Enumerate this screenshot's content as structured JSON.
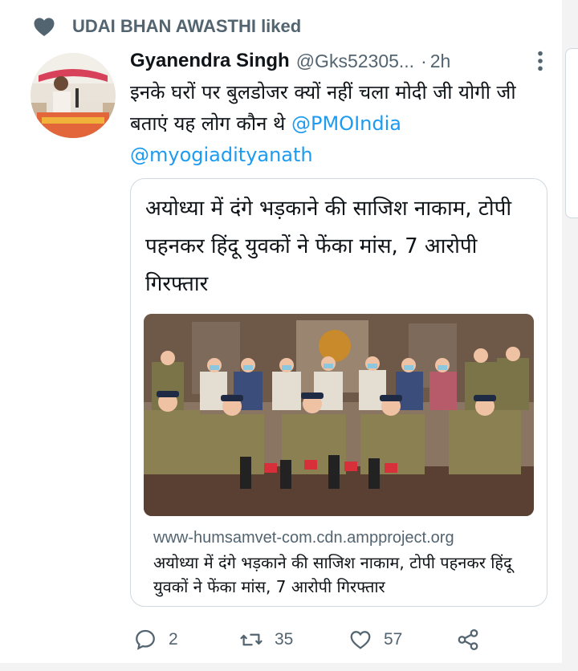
{
  "social_context": {
    "text": "UDAI BHAN AWASTHI liked",
    "icon": "heart-icon"
  },
  "tweet": {
    "author_name": "Gyanendra Singh",
    "handle": "@Gks52305...",
    "separator": "·",
    "time": "2h",
    "text_plain": "इनके घरों पर बुलडोजर क्यों नहीं चला मोदी जी योगी जी बताएं यह लोग कौन थे",
    "mention_1": "@PMOIndia",
    "mention_2": "@myogiadityanath"
  },
  "link_card": {
    "headline": "अयोध्या में दंगे भड़काने की साजिश नाकाम, टोपी पहनकर हिंदू युवकों ने फेंका मांस, 7 आरोपी गिरफ्तार",
    "domain": "www-humsamvet-com.cdn.ampproject.org",
    "description": "अयोध्या में दंगे भड़काने की साजिश नाकाम, टोपी पहनकर हिंदू युवकों ने फेंका मांस, 7 आरोपी गिरफ्तार"
  },
  "actions": {
    "reply_count": "2",
    "retweet_count": "35",
    "like_count": "57"
  },
  "colors": {
    "link": "#1d9bf0",
    "secondary_text": "#536471",
    "border": "#cfd9de"
  }
}
